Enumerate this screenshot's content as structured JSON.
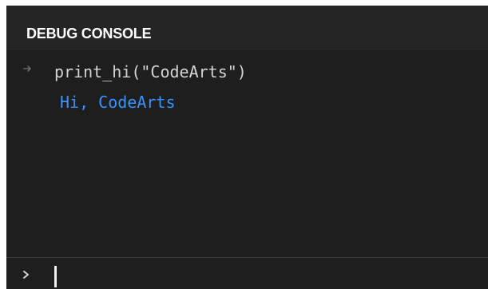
{
  "panel": {
    "title": "DEBUG CONSOLE"
  },
  "output": {
    "lines": [
      {
        "kind": "input",
        "icon": "arrow-right-icon",
        "text": "print_hi(\"CodeArts\")"
      },
      {
        "kind": "result",
        "text": "Hi, CodeArts"
      }
    ]
  },
  "input": {
    "icon": "chevron-right-icon",
    "value": ""
  },
  "colors": {
    "background": "#1e1e1e",
    "header_background": "#252526",
    "command_text": "#d4d4d4",
    "result_text": "#3794ff"
  }
}
